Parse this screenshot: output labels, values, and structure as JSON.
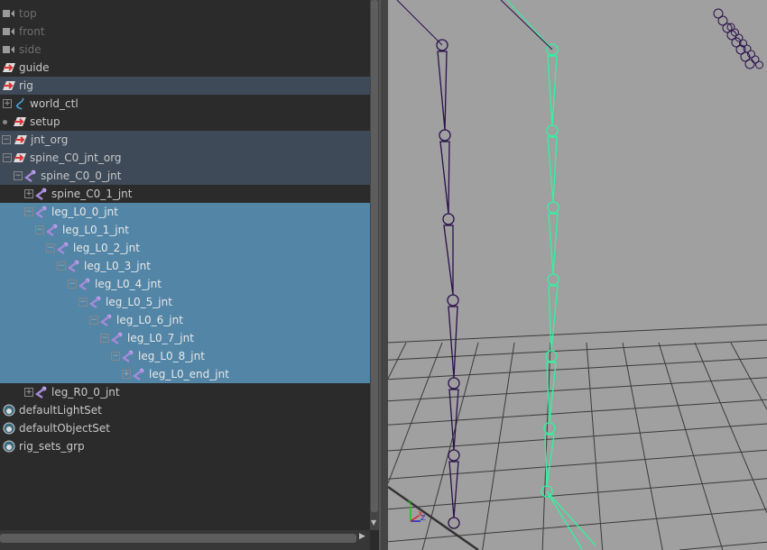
{
  "outliner": {
    "items": [
      {
        "label": "top",
        "icon": "camera-icon",
        "state": "dim"
      },
      {
        "label": "front",
        "icon": "camera-icon",
        "state": "dim"
      },
      {
        "label": "side",
        "icon": "camera-icon",
        "state": "dim"
      },
      {
        "label": "guide",
        "icon": "transform-icon",
        "state": "normal"
      },
      {
        "label": "rig",
        "icon": "transform-icon",
        "state": "highlight"
      },
      {
        "label": "world_ctl",
        "icon": "curve-icon",
        "state": "normal",
        "expander": "+"
      },
      {
        "label": "setup",
        "icon": "transform-icon",
        "state": "normal"
      },
      {
        "label": "jnt_org",
        "icon": "transform-icon",
        "state": "highlight",
        "expander": "-"
      },
      {
        "label": "spine_C0_jnt_org",
        "icon": "transform-icon",
        "state": "highlight",
        "expander": "-"
      },
      {
        "label": "spine_C0_0_jnt",
        "icon": "joint-icon",
        "state": "highlight",
        "expander": "-"
      },
      {
        "label": "spine_C0_1_jnt",
        "icon": "joint-icon",
        "state": "normal",
        "expander": "+"
      },
      {
        "label": "leg_L0_0_jnt",
        "icon": "joint-icon",
        "state": "selected",
        "expander": "-"
      },
      {
        "label": "leg_L0_1_jnt",
        "icon": "joint-icon",
        "state": "selected",
        "expander": "-"
      },
      {
        "label": "leg_L0_2_jnt",
        "icon": "joint-icon",
        "state": "selected",
        "expander": "-"
      },
      {
        "label": "leg_L0_3_jnt",
        "icon": "joint-icon",
        "state": "selected",
        "expander": "-"
      },
      {
        "label": "leg_L0_4_jnt",
        "icon": "joint-icon",
        "state": "selected",
        "expander": "-"
      },
      {
        "label": "leg_L0_5_jnt",
        "icon": "joint-icon",
        "state": "selected",
        "expander": "-"
      },
      {
        "label": "leg_L0_6_jnt",
        "icon": "joint-icon",
        "state": "selected",
        "expander": "-"
      },
      {
        "label": "leg_L0_7_jnt",
        "icon": "joint-icon",
        "state": "selected",
        "expander": "-"
      },
      {
        "label": "leg_L0_8_jnt",
        "icon": "joint-icon",
        "state": "selected",
        "expander": "-"
      },
      {
        "label": "leg_L0_end_jnt",
        "icon": "joint-icon",
        "state": "selected",
        "expander": "+"
      },
      {
        "label": "leg_R0_0_jnt",
        "icon": "joint-icon",
        "state": "normal",
        "expander": "+"
      },
      {
        "label": "defaultLightSet",
        "icon": "set-icon",
        "state": "normal"
      },
      {
        "label": "defaultObjectSet",
        "icon": "set-icon",
        "state": "normal"
      },
      {
        "label": "rig_sets_grp",
        "icon": "set-icon",
        "state": "normal"
      }
    ]
  },
  "viewport": {
    "axis_labels": {
      "x": "X",
      "y": "Y",
      "z": "Z"
    },
    "colors": {
      "background": "#a0a0a0",
      "selected_joint": "#2ef5a0",
      "joint": "#2a0f4a",
      "grid": "#3a3a3a"
    }
  }
}
